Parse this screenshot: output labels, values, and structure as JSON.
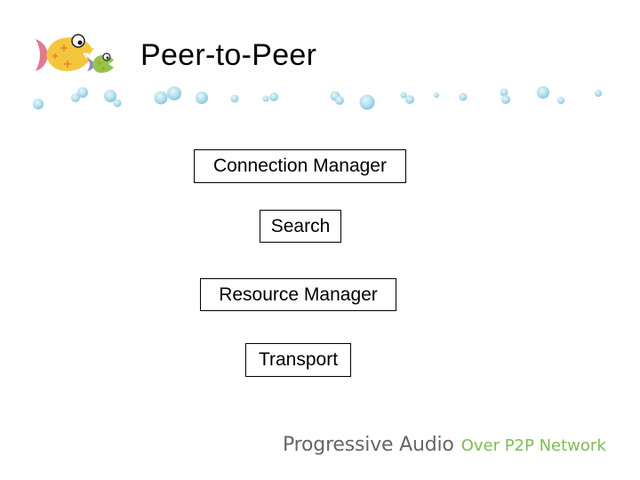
{
  "slide": {
    "title": "Peer-to-Peer",
    "logo": {
      "icon": "fish-logo-icon",
      "description": "Big yellow fish chasing small green fish"
    },
    "decoration": {
      "icon": "bubbles-icon",
      "color": "#a8dcea"
    }
  },
  "diagram": {
    "boxes": [
      {
        "label": "Connection Manager"
      },
      {
        "label": "Search"
      },
      {
        "label": "Resource Manager"
      },
      {
        "label": "Transport"
      }
    ]
  },
  "footer": {
    "brand": "Progressive Audio",
    "tagline": "Over P2P Network",
    "brand_color": "#666666",
    "tagline_color": "#7cbf4f"
  }
}
